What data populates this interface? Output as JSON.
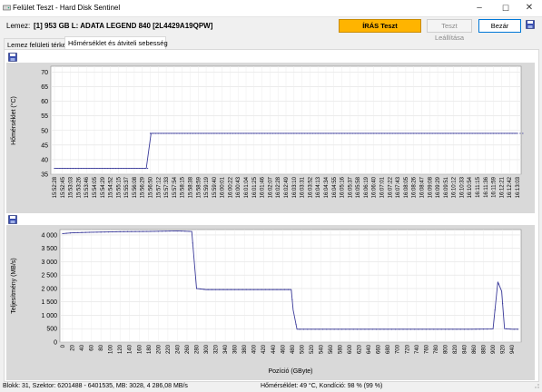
{
  "window": {
    "title": "Felület Teszt - Hard Disk Sentinel",
    "icon": "app-hdd-icon",
    "controls": {
      "minimize": "–",
      "maximize": "☐",
      "close": "✕"
    }
  },
  "toolbar": {
    "disk_label": "Lemez:",
    "disk_name": "[1] 953 GB L: ADATA LEGEND 840 [2L4429A19QPW]",
    "write_test_label": "ÍRÁS Teszt",
    "stop_test_label": "Teszt Leállítása",
    "close_label": "Bezár",
    "accent_color": "#ffb400"
  },
  "tabs": [
    {
      "label": "Lemez felületi térkép",
      "active": false
    },
    {
      "label": "Hőmérséklet és átviteli sebesség",
      "active": true
    }
  ],
  "temp_chart": {
    "ylabel": "Hőmérséklet (°C)",
    "yticks": [
      35,
      40,
      45,
      50,
      55,
      60,
      65,
      70
    ],
    "ylim": [
      35,
      72
    ],
    "xticks": [
      "15:52:28",
      "15:52:45",
      "15:53:03",
      "15:53:26",
      "15:53:46",
      "15:54:05",
      "15:54:29",
      "15:54:52",
      "15:55:15",
      "15:55:37",
      "15:56:08",
      "15:56:29",
      "15:56:50",
      "15:57:12",
      "15:57:33",
      "15:57:54",
      "15:58:15",
      "15:58:38",
      "15:58:59",
      "15:59:19",
      "15:59:40",
      "16:00:01",
      "16:00:22",
      "16:00:43",
      "16:01:04",
      "16:01:25",
      "16:01:46",
      "16:02:07",
      "16:02:28",
      "16:02:49",
      "16:03:10",
      "16:03:31",
      "16:03:52",
      "16:04:13",
      "16:04:34",
      "16:04:55",
      "16:05:16",
      "16:05:37",
      "16:05:58",
      "16:06:19",
      "16:06:40",
      "16:07:01",
      "16:07:22",
      "16:07:43",
      "16:08:05",
      "16:08:26",
      "16:08:47",
      "16:09:08",
      "16:09:29",
      "16:09:51",
      "16:10:12",
      "16:10:33",
      "16:10:54",
      "16:11:15",
      "16:11:36",
      "16:11:59",
      "16:12:21",
      "16:12:42",
      "16:13:03"
    ]
  },
  "speed_chart": {
    "ylabel": "Teljesítmény (MB/s)",
    "xlabel": "Pozíció (GByte)",
    "yticks": [
      "0",
      "500",
      "1 000",
      "1 500",
      "2 000",
      "2 500",
      "3 000",
      "3 500",
      "4 000"
    ],
    "ylim": [
      0,
      4200
    ],
    "xticks": [
      "0",
      "20",
      "40",
      "60",
      "80",
      "100",
      "120",
      "140",
      "160",
      "180",
      "200",
      "220",
      "240",
      "260",
      "280",
      "300",
      "320",
      "340",
      "360",
      "380",
      "400",
      "420",
      "440",
      "460",
      "480",
      "500",
      "520",
      "540",
      "560",
      "580",
      "600",
      "620",
      "640",
      "660",
      "680",
      "700",
      "720",
      "740",
      "760",
      "780",
      "800",
      "820",
      "840",
      "860",
      "880",
      "900",
      "920",
      "940"
    ],
    "xlim": [
      0,
      953
    ]
  },
  "chart_data": [
    {
      "type": "line",
      "title": "",
      "xlabel": "",
      "ylabel": "Hőmérséklet (°C)",
      "ylim": [
        35,
        72
      ],
      "series": [
        {
          "segments": [
            [
              0,
              37
            ],
            [
              11.5,
              37
            ],
            [
              12.1,
              49
            ],
            [
              58,
              49
            ]
          ]
        }
      ],
      "note_x_index_range": [
        0,
        58
      ]
    },
    {
      "type": "line",
      "title": "",
      "xlabel": "Pozíció (GByte)",
      "ylabel": "Teljesítmény (MB/s)",
      "xlim": [
        0,
        953
      ],
      "ylim": [
        0,
        4200
      ],
      "series": [
        {
          "points": [
            [
              0,
              4050
            ],
            [
              20,
              4080
            ],
            [
              60,
              4100
            ],
            [
              120,
              4120
            ],
            [
              180,
              4130
            ],
            [
              240,
              4150
            ],
            [
              270,
              4130
            ],
            [
              275,
              3050
            ],
            [
              280,
              2000
            ],
            [
              300,
              1960
            ],
            [
              350,
              1960
            ],
            [
              400,
              1960
            ],
            [
              450,
              1960
            ],
            [
              478,
              1960
            ],
            [
              482,
              1200
            ],
            [
              490,
              480
            ],
            [
              550,
              480
            ],
            [
              650,
              480
            ],
            [
              750,
              480
            ],
            [
              850,
              480
            ],
            [
              900,
              490
            ],
            [
              910,
              2250
            ],
            [
              918,
              1900
            ],
            [
              924,
              500
            ],
            [
              940,
              480
            ],
            [
              953,
              480
            ]
          ]
        }
      ]
    }
  ],
  "status": {
    "left": "Blokk: 31, Szektor: 6201488 - 6401535, MB: 3028, 4 286,08 MB/s",
    "right": "Hőmérséklet: 49  °C,  Kondíció: 98 % (99 %)"
  }
}
